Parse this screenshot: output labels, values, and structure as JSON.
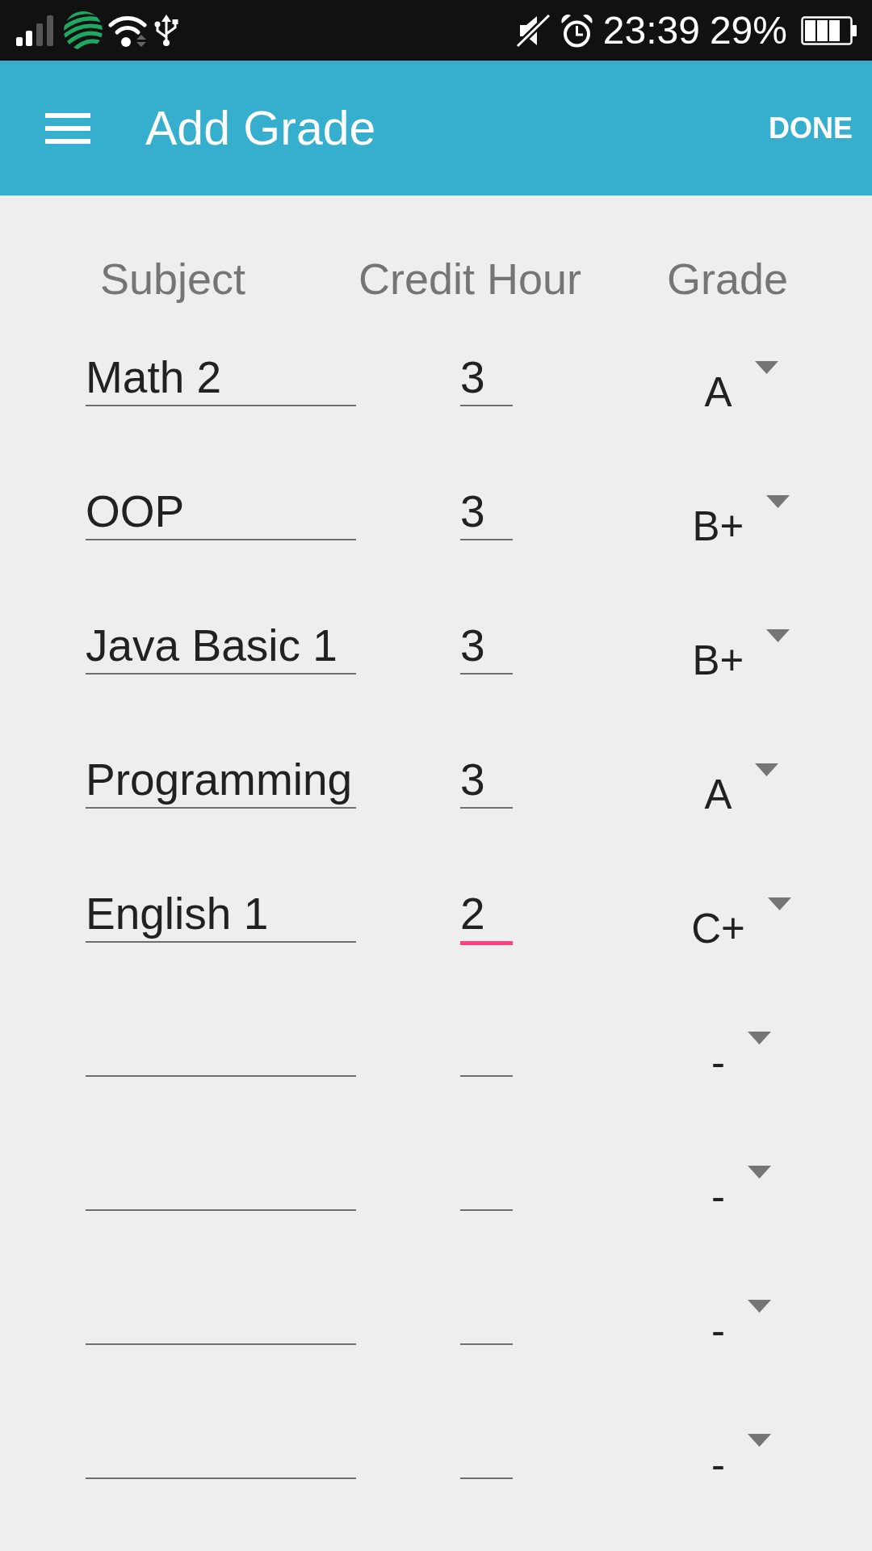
{
  "status_bar": {
    "time": "23:39",
    "battery": "29%"
  },
  "app_bar": {
    "title": "Add Grade",
    "action": "DONE"
  },
  "columns": [
    "Subject",
    "Credit Hour",
    "Grade"
  ],
  "rows": [
    {
      "subject": {
        "value": "Math 2",
        "focused": false
      },
      "credit_hour": {
        "value": "3",
        "focused": false
      },
      "grade": "A"
    },
    {
      "subject": {
        "value": "OOP",
        "focused": false
      },
      "credit_hour": {
        "value": "3",
        "focused": false
      },
      "grade": "B+"
    },
    {
      "subject": {
        "value": "Java Basic 1",
        "focused": false
      },
      "credit_hour": {
        "value": "3",
        "focused": false
      },
      "grade": "B+"
    },
    {
      "subject": {
        "value": "Programming",
        "focused": false
      },
      "credit_hour": {
        "value": "3",
        "focused": false
      },
      "grade": "A"
    },
    {
      "subject": {
        "value": "English 1",
        "focused": false
      },
      "credit_hour": {
        "value": "2",
        "focused": true
      },
      "grade": "C+"
    },
    {
      "subject": {
        "focused": false
      },
      "credit_hour": {
        "focused": false
      },
      "grade": "-"
    },
    {
      "subject": {
        "focused": false
      },
      "credit_hour": {
        "focused": false
      },
      "grade": "-"
    },
    {
      "subject": {
        "focused": false
      },
      "credit_hour": {
        "focused": false
      },
      "grade": "-"
    },
    {
      "subject": {
        "focused": false
      },
      "credit_hour": {
        "focused": false
      },
      "grade": "-"
    }
  ]
}
